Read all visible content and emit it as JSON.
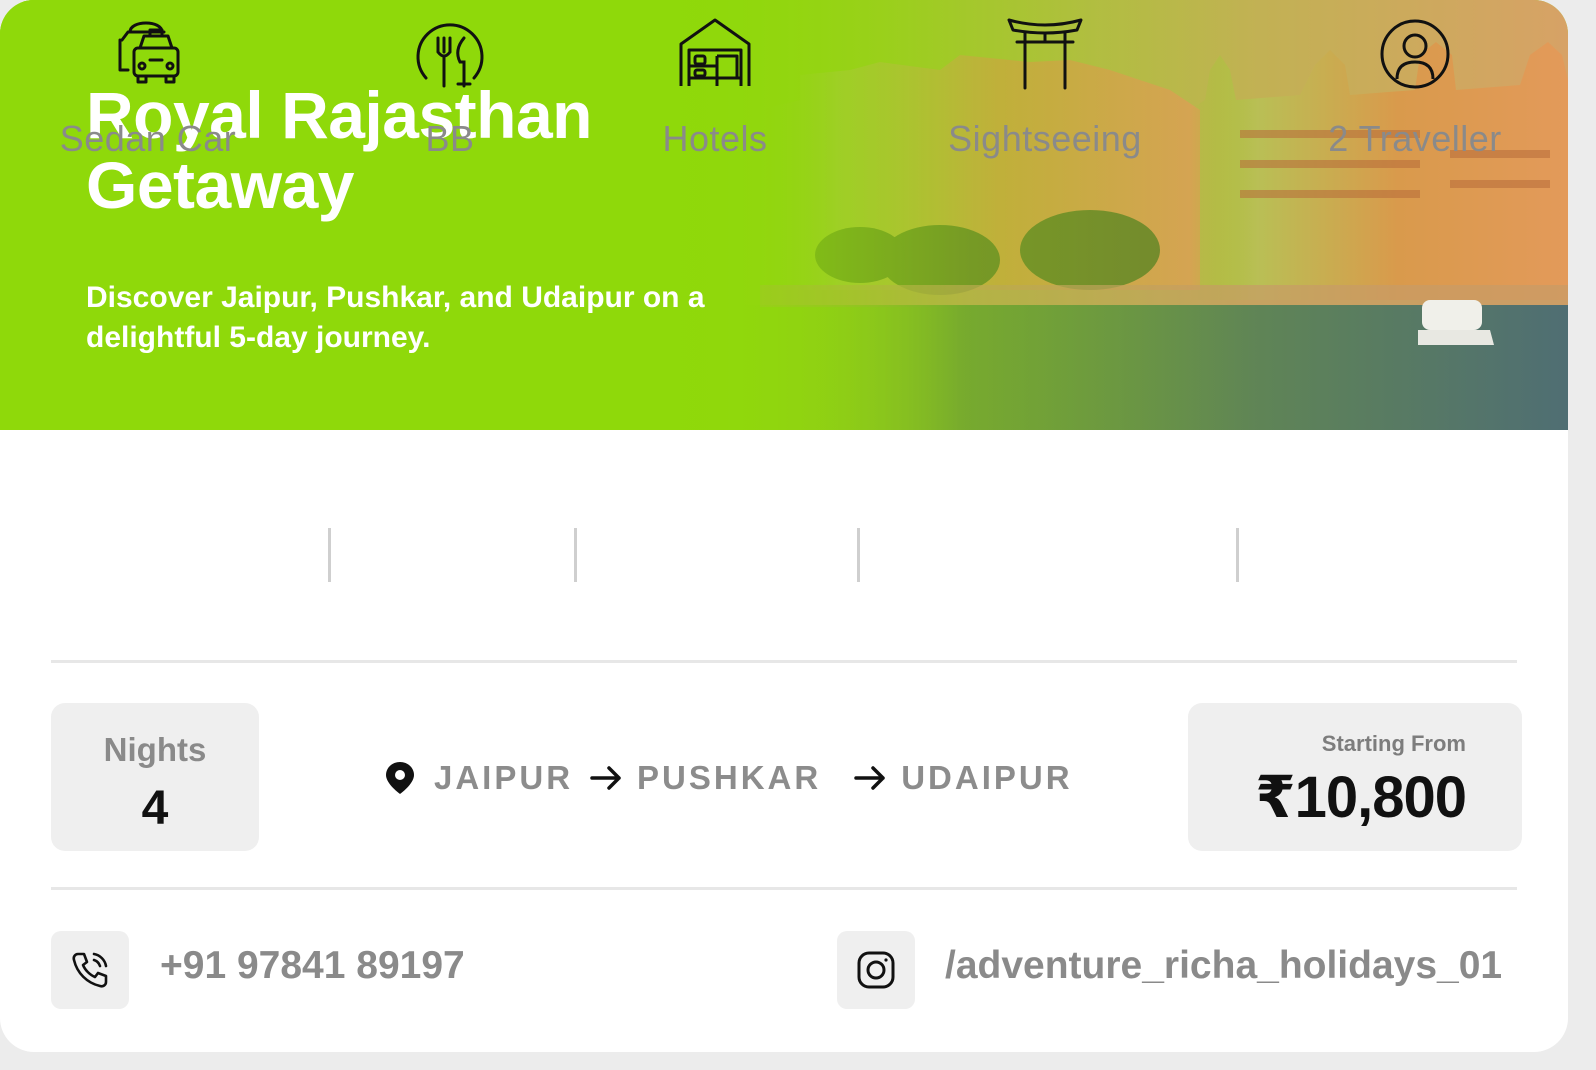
{
  "hero": {
    "title_line1": "Royal Rajasthan",
    "title_line2": "Getaway",
    "subtitle_line1": "Discover Jaipur, Pushkar, and Udaipur on a",
    "subtitle_line2": "delightful 5-day journey.",
    "accent_color": "#8fd90a"
  },
  "features": [
    {
      "label": "Sedan Car",
      "icon": "taxi-car-icon"
    },
    {
      "label": "BB",
      "icon": "fork-knife-plate-icon"
    },
    {
      "label": "Hotels",
      "icon": "hotel-bed-icon"
    },
    {
      "label": "Sightseeing",
      "icon": "torii-gate-icon"
    },
    {
      "label": "2 Traveller",
      "icon": "user-circle-icon"
    }
  ],
  "trip": {
    "nights_label": "Nights",
    "nights_value": "4",
    "route": [
      "JAIPUR",
      "PUSHKAR",
      "UDAIPUR"
    ],
    "price_label": "Starting From",
    "price_value": "₹10,800"
  },
  "contact": {
    "phone": "+91 97841 89197",
    "phone_icon": "phone-call-icon",
    "instagram": "/adventure_richa_holidays_01",
    "instagram_icon": "instagram-icon"
  }
}
